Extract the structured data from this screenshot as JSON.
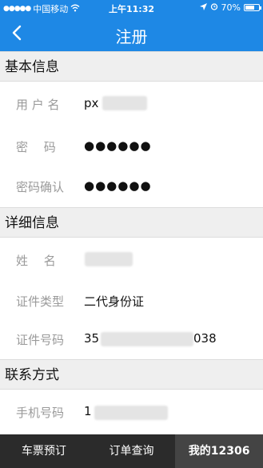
{
  "status_bar": {
    "carrier": "中国移动",
    "time": "上午11:32",
    "battery": "70%",
    "battery_level": 0.7
  },
  "nav": {
    "title": "注册"
  },
  "sections": {
    "basic": {
      "title": "基本信息",
      "username_label": "用 户 名",
      "username_value": "px",
      "password_label": "密　 码",
      "password_value": "●●●●●●",
      "confirm_label": "密码确认",
      "confirm_value": "●●●●●●"
    },
    "detail": {
      "title": "详细信息",
      "name_label": "姓　 名",
      "idtype_label": "证件类型",
      "idtype_value": "二代身份证",
      "idno_label": "证件号码",
      "idno_prefix": "35",
      "idno_suffix": "038"
    },
    "contact": {
      "title": "联系方式",
      "phone_label": "手机号码",
      "phone_prefix": "1"
    }
  },
  "tabs": [
    {
      "label": "车票预订"
    },
    {
      "label": "订单查询"
    },
    {
      "label": "我的12306"
    }
  ]
}
